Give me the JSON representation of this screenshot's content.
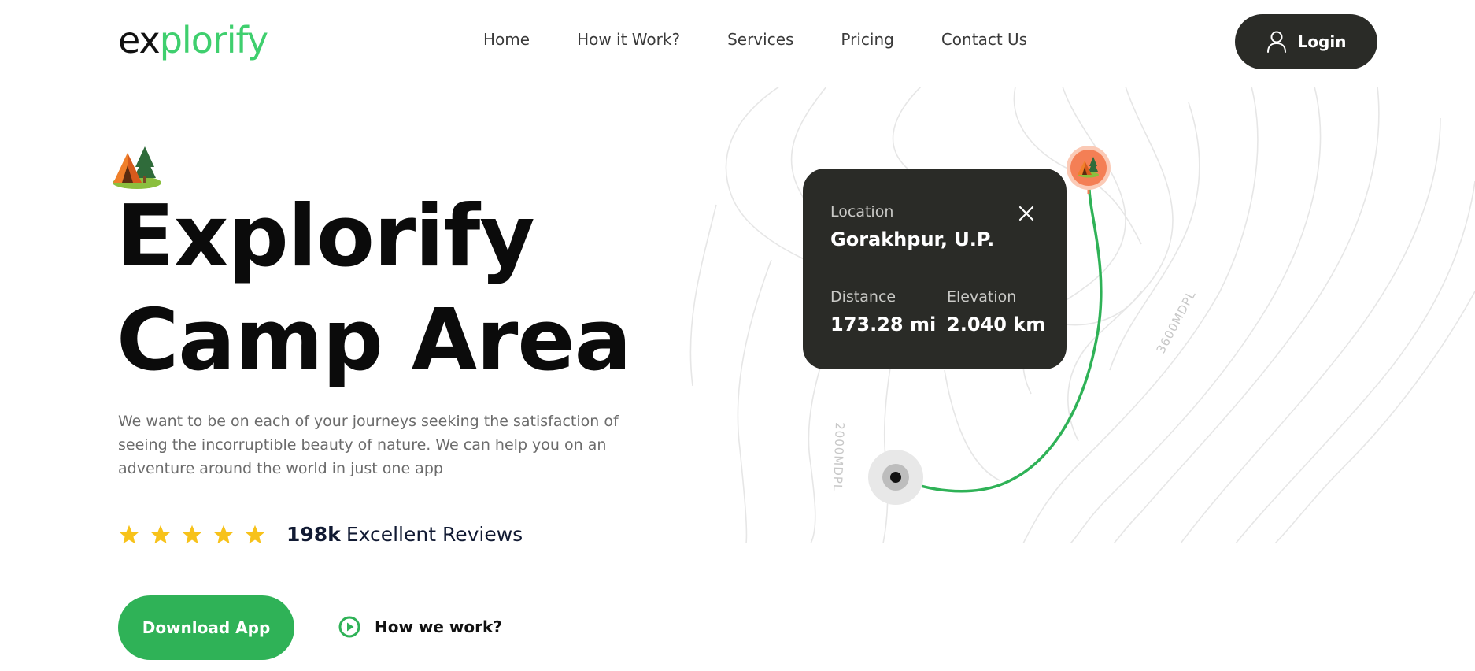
{
  "header": {
    "logo_part1": "ex",
    "logo_part2": "plorify",
    "nav": [
      "Home",
      "How it Work?",
      "Services",
      "Pricing",
      "Contact Us"
    ],
    "login_label": "Login"
  },
  "hero": {
    "title_line1": "Explorify",
    "title_line2": "Camp Area",
    "description": "We want to be on each of your journeys seeking the satisfaction of seeing the incorruptible beauty of nature. We can help you on an adventure around the world in just one app",
    "rating_stars": 5,
    "review_count": "198k",
    "review_label": "Excellent Reviews",
    "download_label": "Download App",
    "how_label": "How we work?"
  },
  "map": {
    "contour_label_1": "3600MDPL",
    "contour_label_2": "2000MDPL",
    "card": {
      "location_label": "Location",
      "location_value": "Gorakhpur, U.P.",
      "distance_label": "Distance",
      "distance_value": "173.28 mi",
      "elevation_label": "Elevation",
      "elevation_value": "2.040 km"
    }
  },
  "colors": {
    "brand_green": "#3fcf6e",
    "button_green": "#2fb257",
    "dark": "#2a2b27",
    "star": "#f7c21a",
    "pin_orange": "#f47f55"
  },
  "icons": [
    "user-icon",
    "tent-icon",
    "star-icon",
    "play-icon",
    "close-icon",
    "map-pin-icon"
  ]
}
